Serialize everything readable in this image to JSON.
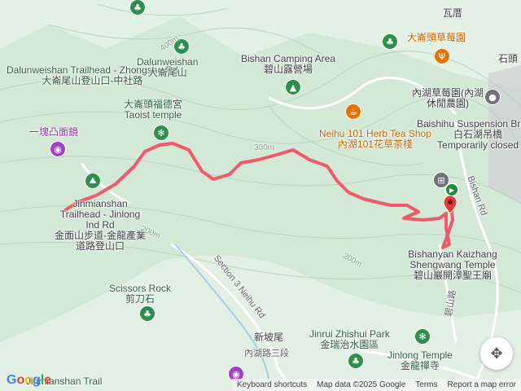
{
  "places": {
    "dalunweishan_trailhead": {
      "en": "Dalunweishan Trailhead - Zhongshe Rd",
      "zh": "大崙尾山登山口-中社路"
    },
    "dalunweishan": {
      "en": "Dalunweishan",
      "zh": "大崙尾山"
    },
    "temple_fude": {
      "zh": "大崙頭福德宮",
      "en": "Taoist temple"
    },
    "bishan_camping": {
      "en": "Bishan Camping Area",
      "zh": "碧山露營場"
    },
    "strawberry_farm": {
      "zh": "大崙頭草莓園"
    },
    "neihu_farm": {
      "zh": "內湖草莓園(內湖休閒農園)"
    },
    "shiding": {
      "zh": "石頭"
    },
    "walei": {
      "zh": "瓦厝"
    },
    "concave_mirror": {
      "zh": "一塊凸面鏡"
    },
    "herb_tea": {
      "en": "Neihu 101 Herb Tea Shop",
      "zh": "內湖101花草茶棧"
    },
    "bridge": {
      "en": "Baishihu Suspension Bridge",
      "zh": "白石湖吊橋",
      "status": "Temporarily closed"
    },
    "jinmianshan_trailhead": {
      "en": "Jinmianshan Trailhead - Jinlong Ind Rd",
      "zh": "金面山步道-金龍產業道路登山口"
    },
    "kaizhang": {
      "en": "Bishanyan Kaizhang Shengwang Temple",
      "zh": "碧山巖開漳聖王廟"
    },
    "scissors": {
      "en": "Scissors Rock",
      "zh": "剪刀石"
    },
    "jinrui": {
      "en": "Jinrui Zhishui Park",
      "zh": "金瑞治水園區"
    },
    "jinlong": {
      "en": "Jinlong Temple",
      "zh": "金龍禪寺"
    },
    "xinpowei": {
      "zh": "新坡尾"
    },
    "jinmianshan_trail": {
      "en": "Jinmianshan Trail"
    }
  },
  "roads": {
    "bishan_rd": "Bishan Rd",
    "neihu_rd": "Section 3 Neihu Rd",
    "neihu_rd_zh": "內湖路三段",
    "bishan_rd_zh": "碧山路"
  },
  "contours": [
    "400m",
    "300m",
    "200m",
    "200m"
  ],
  "footer": {
    "brand": "Google",
    "shortcuts": "Keyboard shortcuts",
    "mapdata": "Map data ©2025 Google",
    "terms": "Terms",
    "report": "Report a map error"
  },
  "colors": {
    "route": "#f05a6a",
    "terrain": "#d4e8d6",
    "accent_green": "#2f8f4e"
  }
}
